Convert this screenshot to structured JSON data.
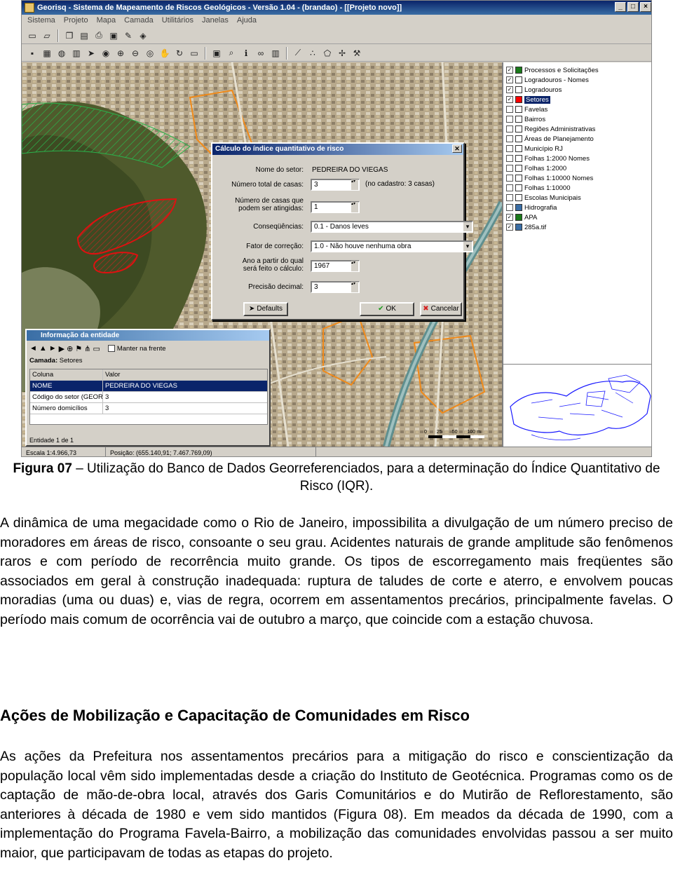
{
  "window": {
    "title": "Georisq - Sistema de Mapeamento de Riscos Geológicos - Versão 1.04 - (brandao) - [[Projeto novo]]",
    "menu": [
      "Sistema",
      "Projeto",
      "Mapa",
      "Camada",
      "Utilitários",
      "Janelas",
      "Ajuda"
    ]
  },
  "legend": {
    "items": [
      {
        "label": "Processos e Solicitações",
        "color": "#1a7a1a",
        "checked": true
      },
      {
        "label": "Logradouros - Nomes",
        "color": "#ffffff",
        "checked": true
      },
      {
        "label": "Logradouros",
        "color": "#ffffff",
        "checked": true
      },
      {
        "label": "Setores",
        "color": "#ff0000",
        "checked": true,
        "selected": true
      },
      {
        "label": "Favelas",
        "color": "#ffffff",
        "checked": false
      },
      {
        "label": "Bairros",
        "color": "#ffffff",
        "checked": false
      },
      {
        "label": "Regiões Administrativas",
        "color": "#ffffff",
        "checked": false
      },
      {
        "label": "Áreas de Planejamento",
        "color": "#ffffff",
        "checked": false
      },
      {
        "label": "Município RJ",
        "color": "#ffffff",
        "checked": false
      },
      {
        "label": "Folhas 1:2000 Nomes",
        "color": "#ffffff",
        "checked": false
      },
      {
        "label": "Folhas 1:2000",
        "color": "#ffffff",
        "checked": false
      },
      {
        "label": "Folhas 1:10000 Nomes",
        "color": "#ffffff",
        "checked": false
      },
      {
        "label": "Folhas 1:10000",
        "color": "#ffffff",
        "checked": false
      },
      {
        "label": "Escolas Municipais",
        "color": "#ffffff",
        "checked": false
      },
      {
        "label": "Hidrografia",
        "color": "#3a6ea5",
        "checked": false
      },
      {
        "label": "APA",
        "color": "#1a7a1a",
        "checked": true
      },
      {
        "label": "285a.tif",
        "color": "#3a6ea5",
        "checked": true
      }
    ]
  },
  "dialog": {
    "title": "Cálculo do índice quantitativo de risco",
    "fields": {
      "sector_label": "Nome do setor:",
      "sector_value": "PEDREIRA DO VIEGAS",
      "houses_label": "Número total de casas:",
      "houses_value": "3",
      "houses_note": "(no cadastro: 3 casas)",
      "affected_label": "Número de casas que podem ser atingidas:",
      "affected_value": "1",
      "consequences_label": "Conseqüências:",
      "consequences_value": "0.1 - Danos leves",
      "correction_label": "Fator de correção:",
      "correction_value": "1.0 - Não houve nenhuma obra",
      "year_label": "Ano a partir do qual será feito o cálculo:",
      "year_value": "1967",
      "precision_label": "Precisão decimal:",
      "precision_value": "3"
    },
    "buttons": {
      "defaults": "Defaults",
      "ok": "OK",
      "cancel": "Cancelar"
    }
  },
  "entity": {
    "title": "Informação da entidade",
    "keep_front": "Manter na frente",
    "layer_label": "Camada:",
    "layer_value": "Setores",
    "headers": {
      "col": "Coluna",
      "val": "Valor"
    },
    "rows": [
      {
        "col": "NOME",
        "val": "PEDREIRA DO VIEGAS"
      },
      {
        "col": "Código do setor (GEORIO)",
        "val": "3"
      },
      {
        "col": "Número domicílios",
        "val": "3"
      }
    ],
    "status": "Entidade 1 de 1"
  },
  "statusbar": {
    "scale": "Escala 1:4.966,73",
    "position": "Posição: (655.140,91; 7.467.769,09)"
  },
  "scalebar": [
    "0",
    "25",
    "50",
    "100 m"
  ],
  "caption": {
    "label": "Figura 07",
    "text": " – Utilização do Banco de Dados Georreferenciados, para a determinação do Índice Quantitativo de Risco (IQR)."
  },
  "paragraph1": "A dinâmica de uma megacidade como o Rio de Janeiro, impossibilita a divulgação de um número preciso de moradores em áreas de risco, consoante o seu grau. Acidentes naturais de grande amplitude são fenômenos raros e com período de recorrência muito grande. Os tipos de escorregamento mais freqüentes são associados em geral à construção inadequada: ruptura de taludes de corte e aterro, e envolvem poucas moradias (uma ou duas) e, vias de regra, ocorrem em assentamentos precários, principalmente favelas. O período mais comum de ocorrência vai de outubro a março, que coincide com a estação chuvosa.",
  "heading": "Ações de Mobilização e Capacitação de Comunidades em Risco",
  "paragraph2": "As ações da Prefeitura nos assentamentos precários para a mitigação do risco e conscientização da população local vêm sido implementadas desde a criação do Instituto de Geotécnica. Programas como os de captação de mão-de-obra local, através dos Garis Comunitários e do Mutirão de Reflorestamento, são anteriores à década de 1980 e vem sido mantidos (Figura 08). Em meados da década de 1990, com a implementação do Programa Favela-Bairro, a mobilização das comunidades envolvidas passou a ser muito maior, que participavam de todas as etapas do projeto."
}
